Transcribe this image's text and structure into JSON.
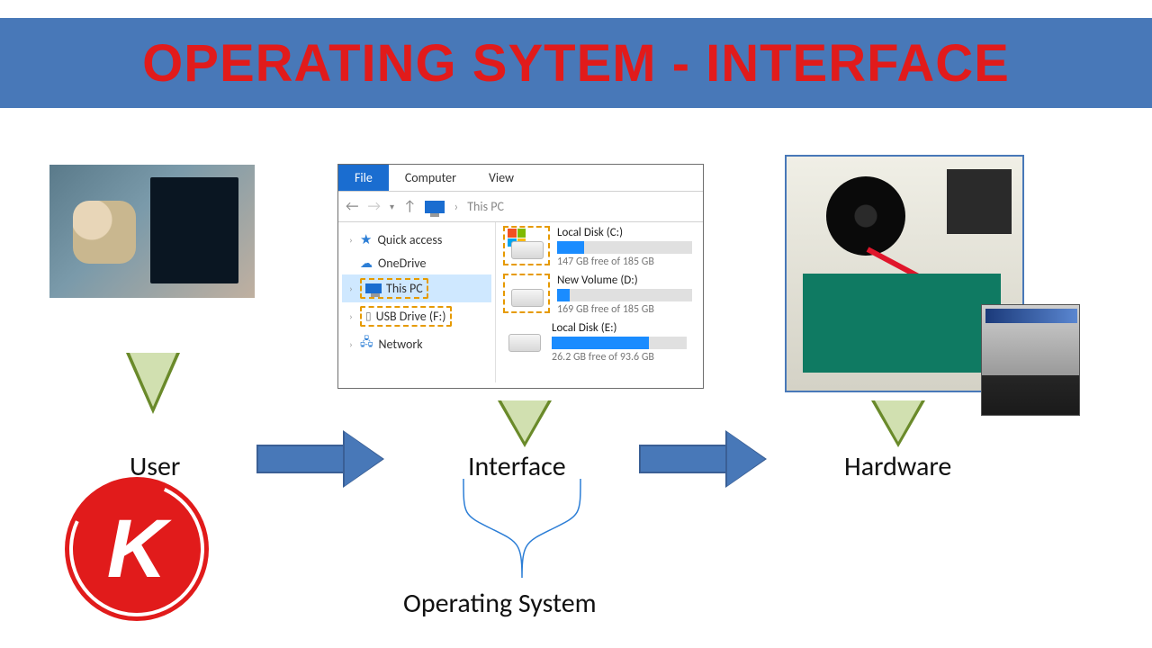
{
  "banner": {
    "title": "OPERATING SYTEM - INTERFACE"
  },
  "explorer": {
    "tabs": {
      "file": "File",
      "computer": "Computer",
      "view": "View"
    },
    "crumb": "This PC",
    "tree": {
      "quick_access": "Quick access",
      "onedrive": "OneDrive",
      "this_pc": "This PC",
      "usb": "USB Drive (F:)",
      "network": "Network"
    },
    "drives": [
      {
        "name": "Local Disk (C:)",
        "free": "147 GB free of 185 GB",
        "ratio": 0.2,
        "win": true
      },
      {
        "name": "New Volume (D:)",
        "free": "169 GB free of 185 GB",
        "ratio": 0.09,
        "win": false
      },
      {
        "name": "Local Disk (E:)",
        "free": "26.2 GB free of 93.6 GB",
        "ratio": 0.72,
        "win": false
      }
    ]
  },
  "labels": {
    "user": "User",
    "interface": "Interface",
    "hardware": "Hardware",
    "os": "Operating System"
  },
  "logo": {
    "letter": "K"
  }
}
